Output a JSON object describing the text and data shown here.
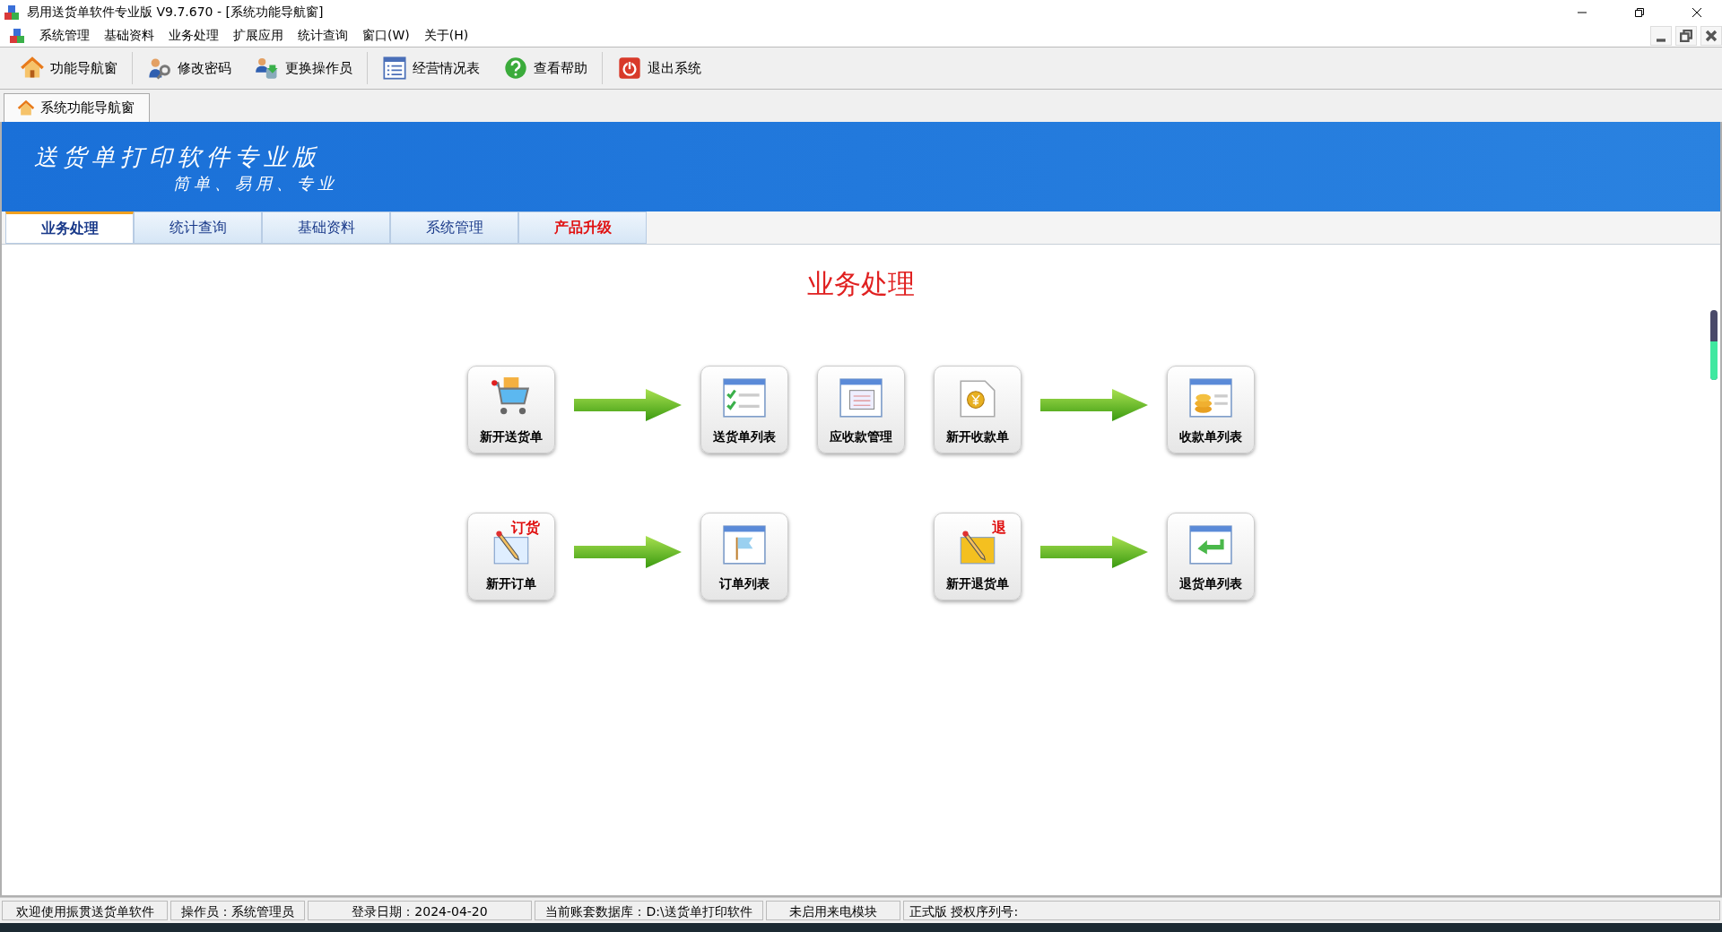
{
  "window": {
    "title": "易用送货单软件专业版 V9.7.670 - [系统功能导航窗]"
  },
  "menu": [
    "系统管理",
    "基础资料",
    "业务处理",
    "扩展应用",
    "统计查询",
    "窗口(W)",
    "关于(H)"
  ],
  "toolbar": [
    {
      "label": "功能导航窗"
    },
    {
      "label": "修改密码"
    },
    {
      "label": "更换操作员"
    },
    {
      "label": "经营情况表"
    },
    {
      "label": "查看帮助"
    },
    {
      "label": "退出系统"
    }
  ],
  "document_tabs": [
    {
      "label": "系统功能导航窗",
      "selected": true
    }
  ],
  "banner": {
    "title": "送货单打印软件专业版",
    "subtitle": "简单、易用、专业"
  },
  "tabs": [
    {
      "label": "业务处理",
      "selected": true,
      "highlight": false
    },
    {
      "label": "统计查询",
      "selected": false,
      "highlight": false
    },
    {
      "label": "基础资料",
      "selected": false,
      "highlight": false
    },
    {
      "label": "系统管理",
      "selected": false,
      "highlight": false
    },
    {
      "label": "产品升级",
      "selected": false,
      "highlight": true
    }
  ],
  "panel": {
    "heading": "业务处理",
    "rows": [
      [
        {
          "kind": "button",
          "label": "新开送货单"
        },
        {
          "kind": "arrow"
        },
        {
          "kind": "button",
          "label": "送货单列表"
        },
        {
          "kind": "button",
          "label": "应收款管理"
        },
        {
          "kind": "button",
          "label": "新开收款单"
        },
        {
          "kind": "arrow"
        },
        {
          "kind": "button",
          "label": "收款单列表"
        }
      ],
      [
        {
          "kind": "button",
          "label": "新开订单",
          "badge": "订货"
        },
        {
          "kind": "arrow"
        },
        {
          "kind": "button",
          "label": "订单列表"
        },
        {
          "kind": "empty"
        },
        {
          "kind": "button",
          "label": "新开退货单",
          "badge": "退"
        },
        {
          "kind": "arrow"
        },
        {
          "kind": "button",
          "label": "退货单列表"
        }
      ]
    ]
  },
  "status_bar": [
    "欢迎使用振贯送货单软件",
    "操作员：系统管理员",
    "登录日期：2024-04-20",
    "当前账套数据库：D:\\送货单打印软件",
    "未启用来电模块",
    "正式版  授权序列号:"
  ]
}
